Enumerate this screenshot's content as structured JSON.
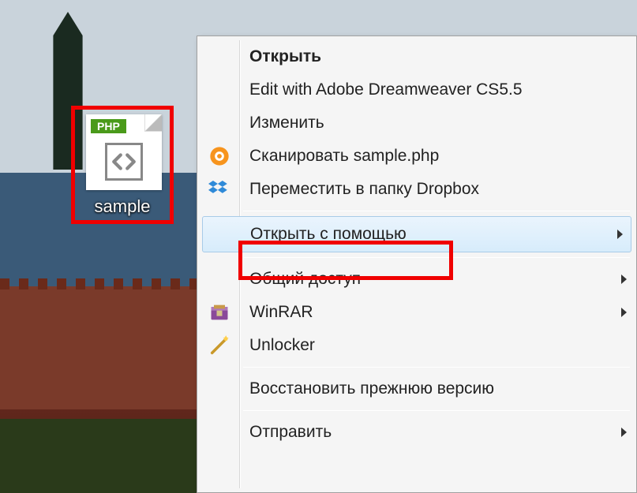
{
  "file": {
    "badge": "PHP",
    "label": "sample"
  },
  "menu": {
    "open": "Открыть",
    "edit_dw": "Edit with Adobe Dreamweaver CS5.5",
    "change": "Изменить",
    "scan": "Сканировать sample.php",
    "dropbox": "Переместить в папку Dropbox",
    "open_with": "Открыть с помощью",
    "share": "Общий доступ",
    "winrar": "WinRAR",
    "unlocker": "Unlocker",
    "restore": "Восстановить прежнюю версию",
    "send": "Отправить"
  }
}
